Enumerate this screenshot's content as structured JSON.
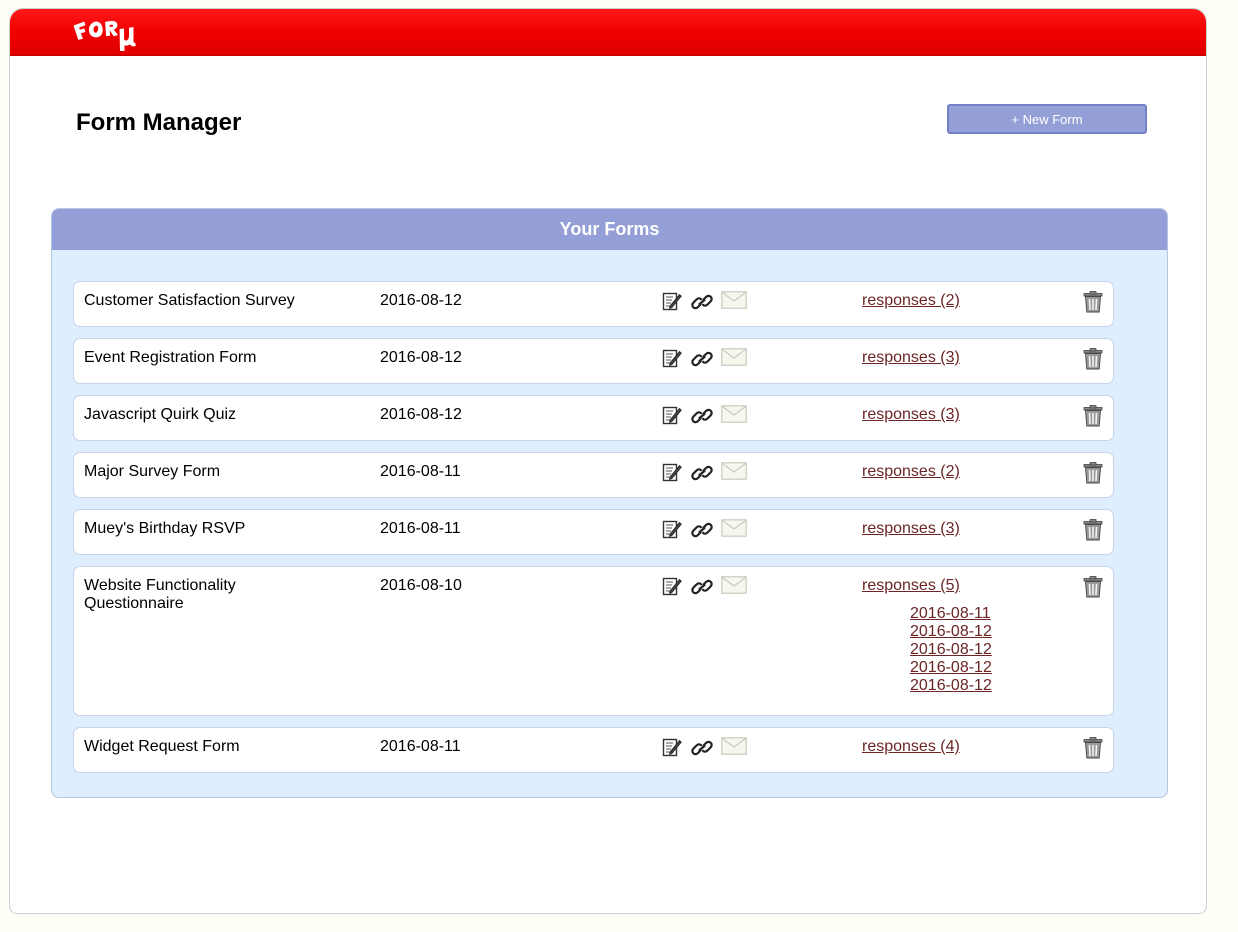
{
  "header": {
    "logo_text": "FORμ",
    "brand_color": "#f00000"
  },
  "page": {
    "title": "Form Manager",
    "new_form_label": "+ New Form"
  },
  "panel": {
    "title": "Your Forms",
    "header_color": "#939fd6",
    "background_color": "#deeefe"
  },
  "forms": [
    {
      "name": "Customer Satisfaction Survey",
      "date": "2016-08-12",
      "responses_label": "responses (2)",
      "response_dates": []
    },
    {
      "name": "Event Registration Form",
      "date": "2016-08-12",
      "responses_label": "responses (3)",
      "response_dates": []
    },
    {
      "name": "Javascript Quirk Quiz",
      "date": "2016-08-12",
      "responses_label": "responses (3)",
      "response_dates": []
    },
    {
      "name": "Major Survey Form",
      "date": "2016-08-11",
      "responses_label": "responses (2)",
      "response_dates": []
    },
    {
      "name": "Muey's Birthday RSVP",
      "date": "2016-08-11",
      "responses_label": "responses (3)",
      "response_dates": []
    },
    {
      "name": "Website Functionality Questionnaire",
      "date": "2016-08-10",
      "responses_label": "responses (5)",
      "response_dates": [
        "2016-08-11",
        "2016-08-12",
        "2016-08-12",
        "2016-08-12",
        "2016-08-12"
      ]
    },
    {
      "name": "Widget Request Form",
      "date": "2016-08-11",
      "responses_label": "responses (4)",
      "response_dates": []
    }
  ],
  "icons": {
    "edit": "edit-icon",
    "link": "link-icon",
    "email": "mail-icon",
    "delete": "trash-icon"
  }
}
